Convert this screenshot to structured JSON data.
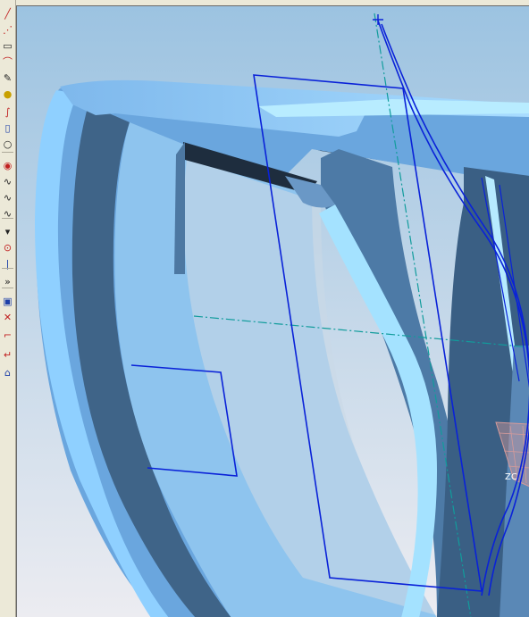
{
  "toolbar": {
    "tools": [
      {
        "icon": "line-icon",
        "glyph": "╱"
      },
      {
        "icon": "point-set-icon",
        "glyph": "⋰"
      },
      {
        "icon": "rectangle-icon",
        "glyph": "▭"
      },
      {
        "icon": "arc-icon",
        "glyph": "⌒"
      },
      {
        "icon": "pen-icon",
        "glyph": "✎"
      },
      {
        "icon": "bulb-icon",
        "glyph": "●"
      },
      {
        "icon": "curve-icon",
        "glyph": "∫"
      },
      {
        "icon": "frame-icon",
        "glyph": "▯"
      },
      {
        "icon": "circle-icon",
        "glyph": "○"
      },
      {
        "icon": "target-icon",
        "glyph": "◉"
      },
      {
        "icon": "spline-icon",
        "glyph": "∿"
      },
      {
        "icon": "spline-icon",
        "glyph": "∿"
      },
      {
        "icon": "spline-icon",
        "glyph": "∿"
      },
      {
        "icon": "dropdown-arrow-icon",
        "glyph": "▾"
      },
      {
        "icon": "revolve-icon",
        "glyph": "⊙"
      },
      {
        "icon": "line-segment-icon",
        "glyph": "|"
      },
      {
        "icon": "more-tools-icon",
        "glyph": "»"
      },
      {
        "icon": "box-icon",
        "glyph": "▣"
      },
      {
        "icon": "cross-icon",
        "glyph": "✕"
      },
      {
        "icon": "trim-icon",
        "glyph": "⌐"
      },
      {
        "icon": "extend-icon",
        "glyph": "↵"
      },
      {
        "icon": "home-icon",
        "glyph": "⌂"
      }
    ]
  },
  "viewport": {
    "axis_label": "ZC",
    "colors": {
      "background_top": "#9ec4e0",
      "background_bottom": "#e9e9ef",
      "surface_light": "#8cc6f6",
      "surface_mid": "#5a88b6",
      "surface_dark": "#3f6488",
      "edge_highlight": "#b6eaff",
      "slot_shadow": "#1e2d3e",
      "sketch_line": "#0a22d8",
      "datum_axis": "#119c9c",
      "csys_plane": "#d59a9a"
    }
  }
}
